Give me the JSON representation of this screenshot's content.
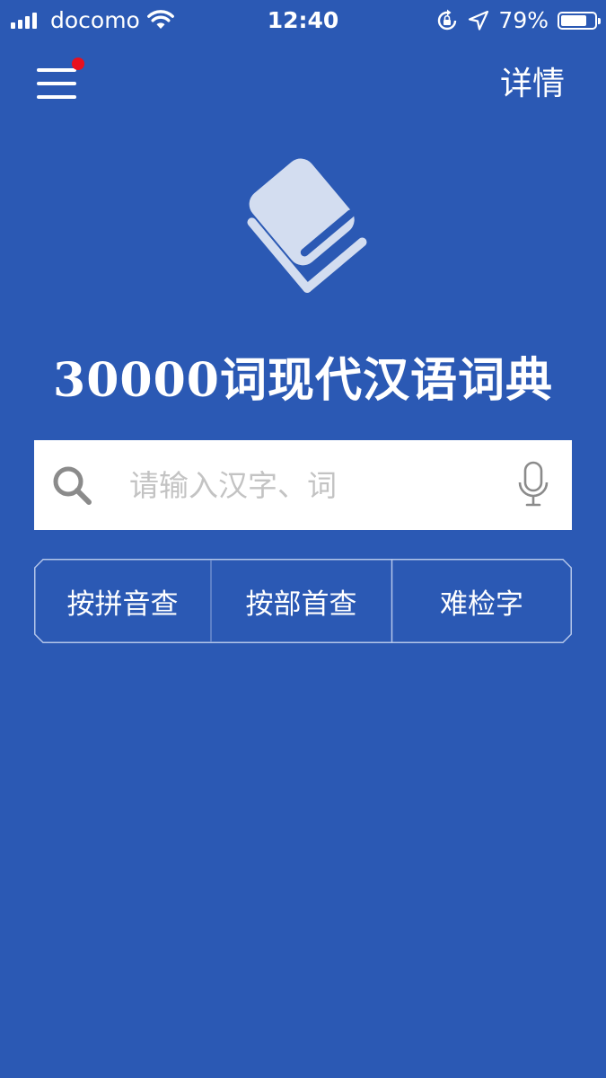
{
  "status_bar": {
    "carrier": "docomo",
    "time": "12:40",
    "battery_percent": "79%",
    "battery_level": 0.79
  },
  "header": {
    "menu_icon": "hamburger-menu-icon",
    "has_notification": true,
    "details_label": "详情"
  },
  "app": {
    "logo_icon": "book-icon",
    "title": "30000词现代汉语词典"
  },
  "search": {
    "placeholder": "请输入汉字、词",
    "value": "",
    "search_icon": "search-icon",
    "voice_icon": "microphone-icon"
  },
  "lookup_modes": [
    {
      "label": "按拼音查"
    },
    {
      "label": "按部首查"
    },
    {
      "label": "难检字"
    }
  ],
  "colors": {
    "background": "#2b59b4",
    "notification_dot": "#e8101e",
    "logo": "#d3ddf0"
  }
}
